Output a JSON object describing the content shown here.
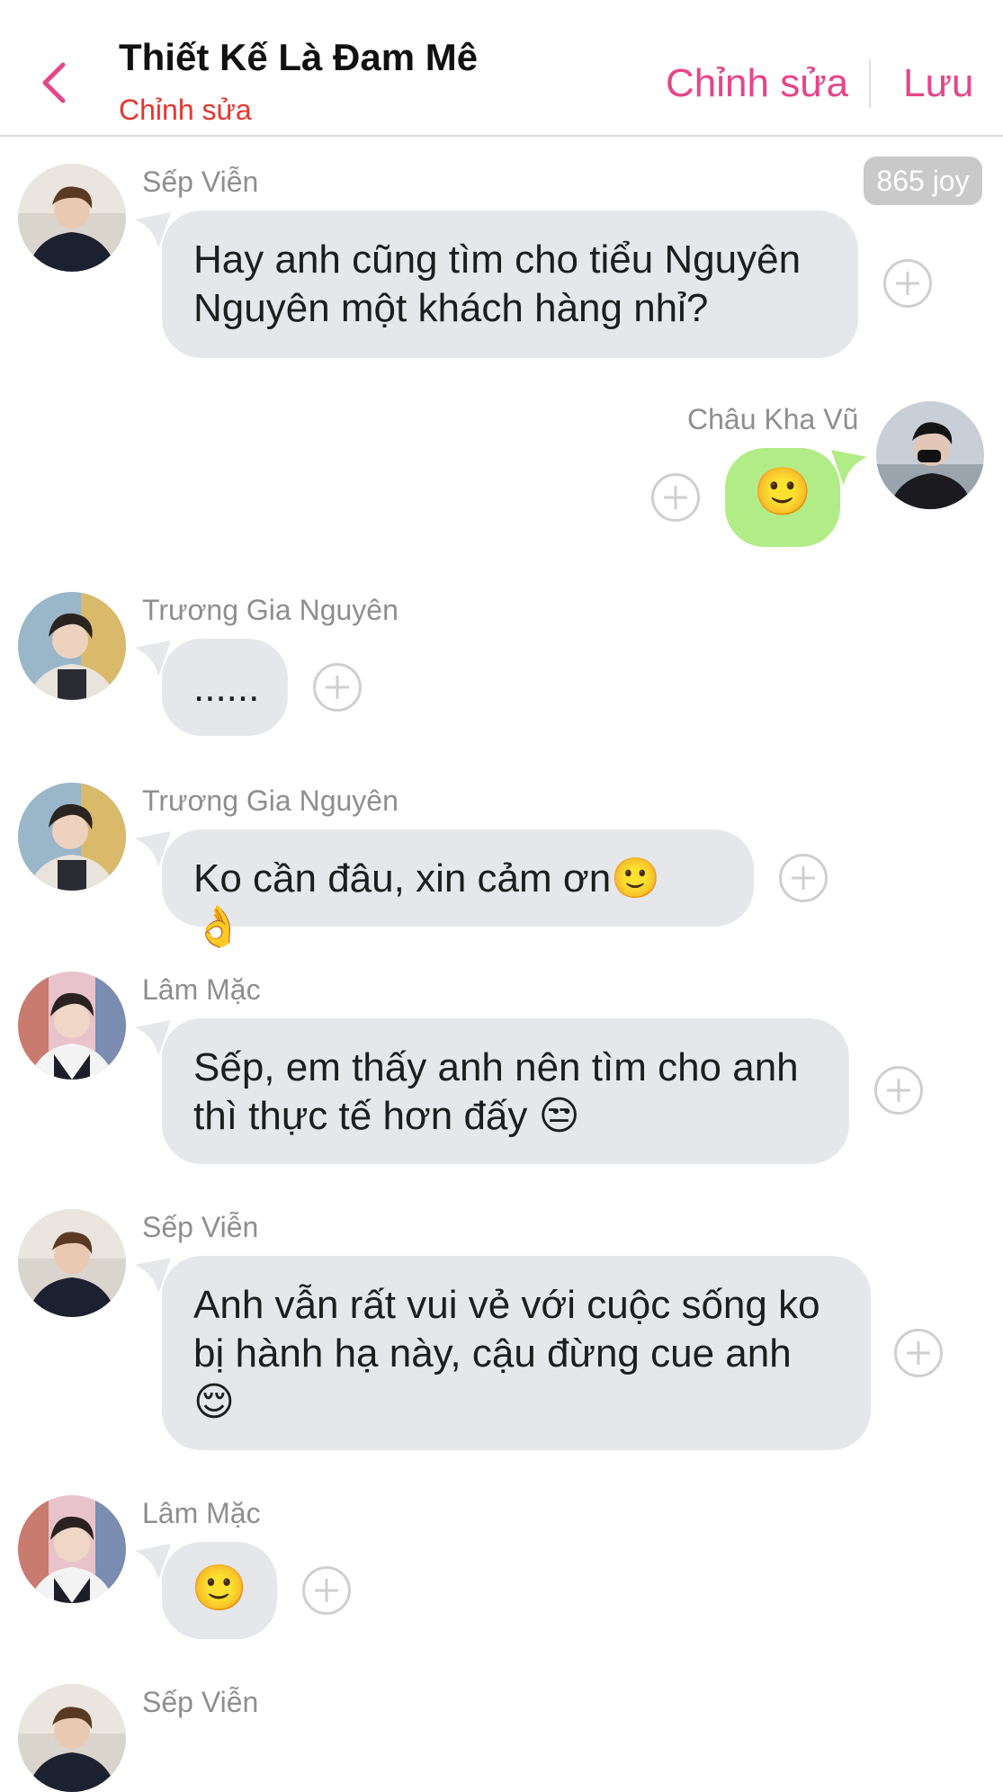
{
  "header": {
    "title": "Thiết Kế Là Đam Mê",
    "subtitle": "Chỉnh sửa",
    "edit_label": "Chỉnh sửa",
    "save_label": "Lưu",
    "accent_color": "#e6458a"
  },
  "badge": {
    "text": "865 joy"
  },
  "messages": [
    {
      "sender": "Sếp Viễn",
      "lines": [
        "Hay anh cũng tìm cho tiểu Nguyên",
        "Nguyên một khách hàng nhỉ?"
      ]
    },
    {
      "sender": "Châu Kha Vũ",
      "text": "🙂",
      "outgoing": true
    },
    {
      "sender": "Trương Gia Nguyên",
      "text": "......"
    },
    {
      "sender": "Trương Gia Nguyên",
      "text": "Ko cần đâu, xin cảm ơn🙂 👌"
    },
    {
      "sender": "Lâm Mặc",
      "lines": [
        "Sếp, em thấy anh nên tìm cho anh",
        "thì thực tế hơn đấy 😒"
      ]
    },
    {
      "sender": "Sếp Viễn",
      "lines": [
        "Anh vẫn rất vui vẻ với cuộc sống ko",
        "bị hành hạ này, cậu đừng cue anh",
        "😌"
      ]
    },
    {
      "sender": "Lâm Mặc",
      "text": "🙂"
    },
    {
      "sender": "Sếp Viễn"
    }
  ]
}
